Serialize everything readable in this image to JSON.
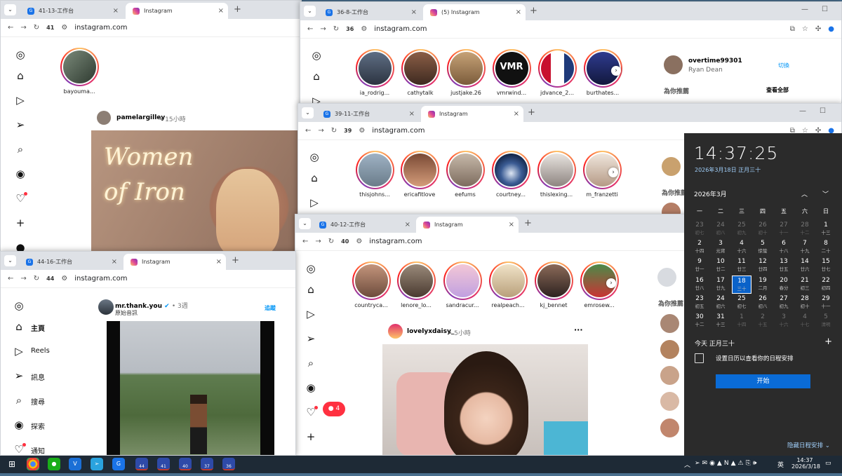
{
  "windows": {
    "w1": {
      "tab1": "41-13-工作台",
      "tab2": "Instagram",
      "num": "41",
      "url": "instagram.com",
      "story": "bayouma...",
      "post_user": "pamelargilley",
      "post_time": "15小時",
      "image_text_1": "Women",
      "image_text_2": "of Iron"
    },
    "w2": {
      "tab1": "36-8-工作台",
      "tab2": "(5) Instagram",
      "num": "36",
      "url": "instagram.com",
      "stories": [
        "ia_rodrig...",
        "cathytalk",
        "justjake.26",
        "vmrwind...",
        "jdvance_2...",
        "burthates..."
      ],
      "vmr_text": "VMR",
      "acct_user": "overtime99301",
      "acct_name": "Ryan Dean",
      "switch": "切換",
      "suggest": "為你推薦",
      "see_all": "查看全部"
    },
    "w3": {
      "tab1": "39-11-工作台",
      "tab2": "Instagram",
      "num": "39",
      "url": "instagram.com",
      "stories": [
        "thisjohns...",
        "ericafitlove",
        "eefums",
        "courtney...",
        "thislexing...",
        "m_franzetti"
      ],
      "suggest": "為你推薦"
    },
    "w4": {
      "tab1": "40-12-工作台",
      "tab2": "Instagram",
      "num": "40",
      "url": "instagram.com",
      "stories": [
        "countryca...",
        "lenore_lo...",
        "sandracur...",
        "realpeach...",
        "kj_bennet",
        "emrosew..."
      ],
      "post_user": "lovelyxdaisy_",
      "post_time": "5小時",
      "notif_count": "4",
      "suggest": "為你推薦"
    },
    "w5": {
      "tab1": "44-16-工作台",
      "tab2": "Instagram",
      "num": "44",
      "url": "instagram.com",
      "nav": [
        "主頁",
        "Reels",
        "訊息",
        "搜尋",
        "探索",
        "通知"
      ],
      "post_user": "mr.thank.you",
      "post_time": "3週",
      "post_sub": "原始音訊",
      "follow": "追蹤"
    }
  },
  "calendar": {
    "time": "14:37:25",
    "date": "2026年3月18日 正月三十",
    "month": "2026年3月",
    "weekdays": [
      "一",
      "二",
      "三",
      "四",
      "五",
      "六",
      "日"
    ],
    "days": [
      [
        "23",
        "初七"
      ],
      [
        "24",
        "初八"
      ],
      [
        "25",
        "初九"
      ],
      [
        "26",
        "初十"
      ],
      [
        "27",
        "十一"
      ],
      [
        "28",
        "十二"
      ],
      [
        "1",
        "十三"
      ],
      [
        "2",
        "十四"
      ],
      [
        "3",
        "元宵"
      ],
      [
        "4",
        "十六"
      ],
      [
        "5",
        "惊蛰"
      ],
      [
        "6",
        "十八"
      ],
      [
        "7",
        "十九"
      ],
      [
        "8",
        "二十"
      ],
      [
        "9",
        "廿一"
      ],
      [
        "10",
        "廿二"
      ],
      [
        "11",
        "廿三"
      ],
      [
        "12",
        "廿四"
      ],
      [
        "13",
        "廿五"
      ],
      [
        "14",
        "廿六"
      ],
      [
        "15",
        "廿七"
      ],
      [
        "16",
        "廿八"
      ],
      [
        "17",
        "廿九"
      ],
      [
        "18",
        "三十"
      ],
      [
        "19",
        "二月"
      ],
      [
        "20",
        "春分"
      ],
      [
        "21",
        "初三"
      ],
      [
        "22",
        "初四"
      ],
      [
        "23",
        "初五"
      ],
      [
        "24",
        "初六"
      ],
      [
        "25",
        "初七"
      ],
      [
        "26",
        "初八"
      ],
      [
        "27",
        "初九"
      ],
      [
        "28",
        "初十"
      ],
      [
        "29",
        "十一"
      ],
      [
        "30",
        "十二"
      ],
      [
        "31",
        "十三"
      ],
      [
        "1",
        "十四"
      ],
      [
        "2",
        "十五"
      ],
      [
        "3",
        "十六"
      ],
      [
        "4",
        "十七"
      ],
      [
        "5",
        "清明"
      ]
    ],
    "today_label": "今天 正月三十",
    "empty_text": "设置日历以查看你的日程安排",
    "start": "开始",
    "hide": "隐藏日程安排"
  },
  "taskbar": {
    "time": "14:37",
    "date": "2026/3/18",
    "lang": "英",
    "badges": [
      "44",
      "41",
      "40",
      "37",
      "36"
    ]
  }
}
